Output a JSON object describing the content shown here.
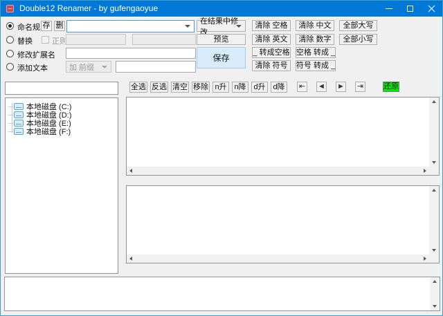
{
  "window": {
    "title": "Double12 Renamer - by gufengaoyue"
  },
  "rules": {
    "naming": {
      "label": "命名规则",
      "save": "存",
      "del": "删",
      "combo_value": ""
    },
    "replace": {
      "label": "替换",
      "regex": "正则",
      "find_value": "",
      "to_value": ""
    },
    "ext": {
      "label": "修改扩展名",
      "value": ""
    },
    "addtext": {
      "label": "添加文本",
      "mode_value": "加 前缀",
      "text_value": ""
    }
  },
  "actions": {
    "target_combo": "在结果中修改",
    "preview": "预览",
    "save": "保存",
    "grid": {
      "r1c1": "清除 空格",
      "r1c2": "清除 中文",
      "r1c3": "全部大写",
      "r2c1": "清除 英文",
      "r2c2": "清除 数字",
      "r2c3": "全部小写",
      "r3c1": "_ 转成空格",
      "r3c2": "空格 转成 _",
      "r4c1": "清除 符号",
      "r4c2": "符号 转成 _"
    }
  },
  "toolbar": {
    "buttons": [
      "全选",
      "反选",
      "清空",
      "移除",
      "n升",
      "n降",
      "d升",
      "d降"
    ],
    "nav": [
      {
        "name": "move-to-start-icon",
        "glyph": "⇤"
      },
      {
        "name": "move-left-icon",
        "glyph": "◄"
      },
      {
        "name": "move-right-icon",
        "glyph": "►"
      },
      {
        "name": "move-to-end-icon",
        "glyph": "⇥"
      }
    ],
    "restore": "还原",
    "restore_color": "#00ef00"
  },
  "sidebar": {
    "filter_value": "",
    "drives": [
      {
        "label": "本地磁盘 (C:)"
      },
      {
        "label": "本地磁盘 (D:)"
      },
      {
        "label": "本地磁盘 (E:)"
      },
      {
        "label": "本地磁盘 (F:)"
      }
    ]
  },
  "colors": {
    "titlebar": "#0078d7",
    "window_border": "#3f9ec0",
    "save_button_bg": "#d9ecf9",
    "restore_button_bg": "#00ef00"
  }
}
